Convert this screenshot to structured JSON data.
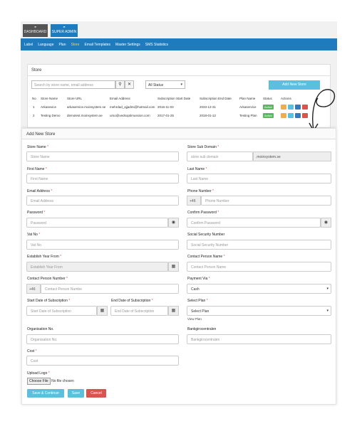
{
  "top": {
    "dashboard": "DASHBOARD",
    "superadmin": "SUPER ADMIN"
  },
  "nav": [
    "Label",
    "Language",
    "Plan",
    "Store",
    "Email Templates",
    "Master Settings",
    "SMS Statistics"
  ],
  "store_panel": {
    "title": "Store",
    "search_placeholder": "Search by store name, email address",
    "status": "All Status",
    "add": "Add New Store",
    "headers": [
      "No",
      "Store Name",
      "Store URL",
      "Email Address",
      "Subscription Start Date",
      "Subscription End Date",
      "Plan Name",
      "Status",
      "Actions"
    ],
    "rows": [
      [
        "1",
        "Arkasevice",
        "arkaservice.moinsystem.se",
        "mehrdad_ajjadmi@hotmail.com",
        "2016-11-03",
        "2033-12-31",
        "Arkaservice",
        "Active"
      ],
      [
        "2",
        "Testing Demo",
        "demotest.moinsystem.se",
        "urso@vedsoptimussion.com",
        "2017-01-25",
        "2018-01-12",
        "Testing Plan",
        "Active"
      ]
    ]
  },
  "form": {
    "title": "Add New Store",
    "store_name": {
      "label": "Store Name",
      "ph": "Store Name"
    },
    "sub_domain": {
      "label": "Store Sub Domain",
      "ph": "store sub domain",
      "suffix": ".moinsystem.se"
    },
    "first_name": {
      "label": "First Name",
      "ph": "First Name"
    },
    "last_name": {
      "label": "Last Name",
      "ph": "Last Name"
    },
    "email": {
      "label": "Email Address",
      "ph": "Email Address"
    },
    "phone": {
      "label": "Phone Number",
      "prefix": "+46",
      "ph": "Phone Number"
    },
    "password": {
      "label": "Password",
      "ph": "Password"
    },
    "confirm": {
      "label": "Confirm Password",
      "ph": "Confirm Password"
    },
    "vat": {
      "label": "Vat No",
      "ph": "Vat No"
    },
    "ssn": {
      "label": "Social Security Number",
      "ph": "Social Security Number"
    },
    "est": {
      "label": "Establish Year From",
      "ph": "Establish Year From"
    },
    "cpn": {
      "label": "Contact Person Name",
      "ph": "Contact Person Name"
    },
    "cpnum": {
      "label": "Contact Person Number",
      "prefix": "+46",
      "ph": "Contact Person Numbe"
    },
    "payment": {
      "label": "Payment Via",
      "value": "Cash"
    },
    "start": {
      "label": "Start Date of Subscription",
      "ph": "Start Date of Subscription"
    },
    "end": {
      "label": "End Date of Subscription",
      "ph": "End Date of Subscription"
    },
    "plan": {
      "label": "Select Plan",
      "value": "Select Plan",
      "view": "View Plan"
    },
    "org": {
      "label": "Organisation No.",
      "ph": "Organisation No."
    },
    "bank": {
      "label": "Bankgirocentralen",
      "ph": "Bankgirocentralen"
    },
    "cost": {
      "label": "Cost",
      "ph": "Cost"
    },
    "logo": {
      "label": "Upload Logo",
      "choose": "Choose File",
      "none": "No file chosen"
    },
    "buttons": {
      "save_continue": "Save & Continue",
      "save": "Save",
      "cancel": "Cancel"
    }
  },
  "colors": {
    "primary": "#1e7bbd",
    "info": "#5bc0de",
    "success": "#5cb85c",
    "danger": "#d9534f"
  }
}
